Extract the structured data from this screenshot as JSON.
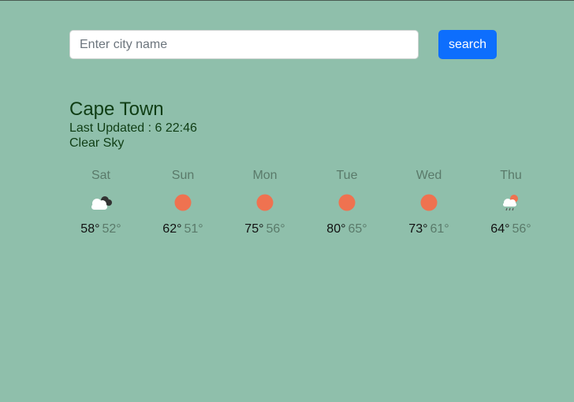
{
  "search": {
    "placeholder": "Enter city name",
    "value": "",
    "button_label": "search"
  },
  "current": {
    "city": "Cape Town",
    "updated": "Last Updated : 6 22:46",
    "condition": "Clear Sky"
  },
  "forecast": [
    {
      "day": "Sat",
      "icon": "cloudy-icon",
      "hi": "58°",
      "lo": "52°"
    },
    {
      "day": "Sun",
      "icon": "sun-icon",
      "hi": "62°",
      "lo": "51°"
    },
    {
      "day": "Mon",
      "icon": "sun-icon",
      "hi": "75°",
      "lo": "56°"
    },
    {
      "day": "Tue",
      "icon": "sun-icon",
      "hi": "80°",
      "lo": "65°"
    },
    {
      "day": "Wed",
      "icon": "sun-icon",
      "hi": "73°",
      "lo": "61°"
    },
    {
      "day": "Thu",
      "icon": "rain-icon",
      "hi": "64°",
      "lo": "56°"
    }
  ],
  "colors": {
    "background": "#8fbfab",
    "accent": "#0d6efd",
    "sun": "#ef7250"
  }
}
